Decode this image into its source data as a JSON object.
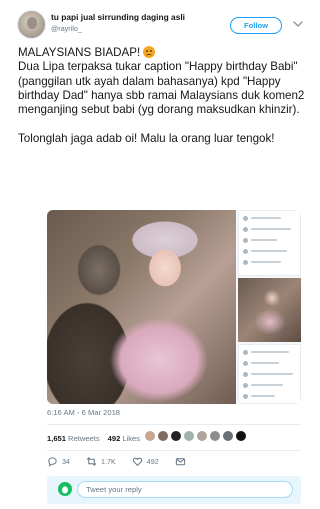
{
  "author": {
    "display_name": "tu papi jual sirrunding daging asli",
    "username": "@rayrilo_",
    "follow_label": "Follow"
  },
  "tweet": {
    "text_line1": "MALAYSIANS BIADAP! ",
    "text_rest": "Dua Lipa terpaksa tukar caption \"Happy birthday Babi\" (panggilan utk ayah dalam bahasanya) kpd \"Happy birthday Dad\" hanya sbb ramai Malaysians duk komen2 menganjing sebut babi (yg dorang maksudkan khinzir).\n\nTolonglah jaga adab oi! Malu la orang luar tengok!",
    "emoji_icon": "angry-face-icon",
    "timestamp": "6:16 AM - 6 Mar 2018"
  },
  "stats": {
    "retweets_count": "1,651",
    "retweets_label": "Retweets",
    "likes_count": "492",
    "likes_label": "Likes",
    "liker_colors": [
      "#c9a48f",
      "#7e6b62",
      "#222222",
      "#9fb3a8",
      "#b0a59a",
      "#8d8d8d",
      "#6b6f78",
      "#111111"
    ]
  },
  "actions": {
    "reply_count": "34",
    "retweet_count": "1.7K",
    "like_count": "492"
  },
  "reply": {
    "placeholder": "Tweet your reply"
  },
  "colors": {
    "accent": "#1da1f2",
    "text": "#14171a",
    "muted": "#657786",
    "reply_bg": "#e8f5fd"
  }
}
